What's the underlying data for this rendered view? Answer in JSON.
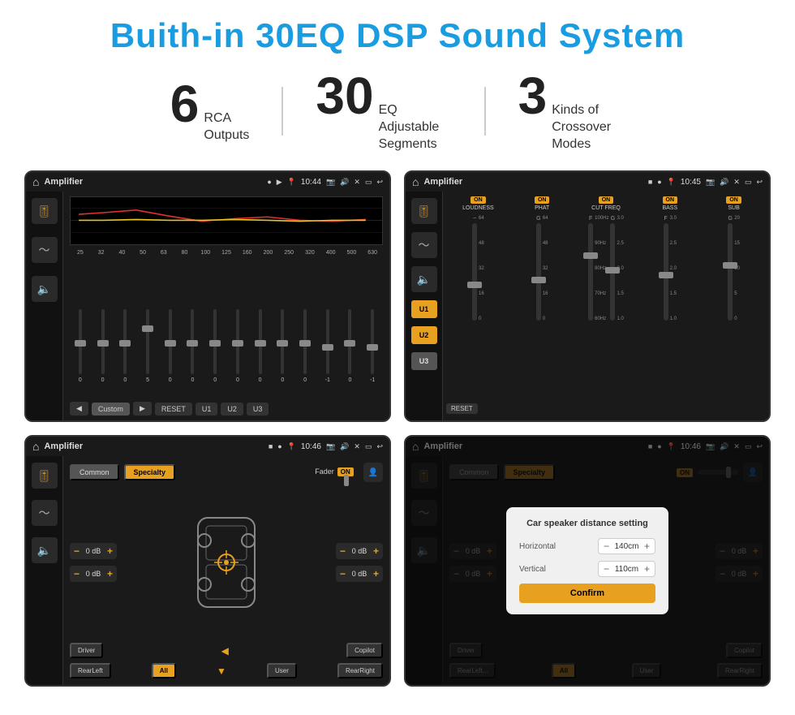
{
  "header": {
    "title": "Buith-in 30EQ DSP Sound System"
  },
  "stats": [
    {
      "number": "6",
      "text": "RCA\nOutputs"
    },
    {
      "number": "30",
      "text": "EQ Adjustable\nSegments"
    },
    {
      "number": "3",
      "text": "Kinds of\nCrossover Modes"
    }
  ],
  "screen1": {
    "status": {
      "title": "Amplifier",
      "time": "10:44"
    },
    "eq_freqs": [
      "25",
      "32",
      "40",
      "50",
      "63",
      "80",
      "100",
      "125",
      "160",
      "200",
      "250",
      "320",
      "400",
      "500",
      "630"
    ],
    "eq_values": [
      "0",
      "0",
      "0",
      "5",
      "0",
      "0",
      "0",
      "0",
      "0",
      "0",
      "0",
      "-1",
      "0",
      "-1"
    ],
    "bottom_btns": [
      "◀",
      "Custom",
      "▶",
      "RESET",
      "U1",
      "U2",
      "U3"
    ]
  },
  "screen2": {
    "status": {
      "title": "Amplifier",
      "time": "10:45"
    },
    "presets": [
      "U1",
      "U2",
      "U3"
    ],
    "channels": [
      "LOUDNESS",
      "PHAT",
      "CUT FREQ",
      "BASS",
      "SUB"
    ],
    "reset_label": "RESET"
  },
  "screen3": {
    "status": {
      "title": "Amplifier",
      "time": "10:46"
    },
    "tabs": [
      "Common",
      "Specialty"
    ],
    "active_tab": "Specialty",
    "fader_label": "Fader",
    "fader_on": "ON",
    "channel_labels": [
      "Driver",
      "RearLeft",
      "All",
      "User",
      "RearRight",
      "Copilot"
    ],
    "db_values": [
      "0 dB",
      "0 dB",
      "0 dB",
      "0 dB"
    ]
  },
  "screen4": {
    "status": {
      "title": "Amplifier",
      "time": "10:46"
    },
    "tabs": [
      "Common",
      "Specialty"
    ],
    "dialog": {
      "title": "Car speaker distance setting",
      "horizontal_label": "Horizontal",
      "horizontal_value": "140cm",
      "vertical_label": "Vertical",
      "vertical_value": "110cm",
      "confirm_label": "Confirm"
    },
    "db_values": [
      "0 dB",
      "0 dB"
    ],
    "bottom_btns": [
      "Driver",
      "RearLeft",
      "All",
      "User",
      "RearRight",
      "Copilot"
    ]
  }
}
